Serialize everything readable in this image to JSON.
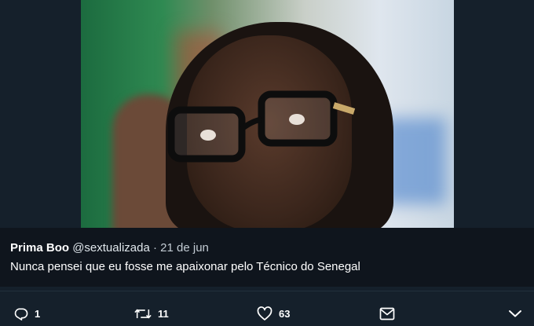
{
  "tweet": {
    "display_name": "Prima Boo",
    "handle": "@sextualizada",
    "separator": "·",
    "date": "21 de jun",
    "text": "Nunca pensei que eu fosse me apaixonar pelo Técnico do Senegal"
  },
  "actions": {
    "reply": {
      "icon": "reply-icon",
      "count": "1"
    },
    "retweet": {
      "icon": "retweet-icon",
      "count": "11"
    },
    "like": {
      "icon": "heart-icon",
      "count": "63"
    },
    "message": {
      "icon": "envelope-icon"
    },
    "more": {
      "icon": "chevron-down-icon"
    }
  },
  "colors": {
    "background": "#15202b",
    "text": "#ffffff",
    "icon": "#ffffff"
  }
}
